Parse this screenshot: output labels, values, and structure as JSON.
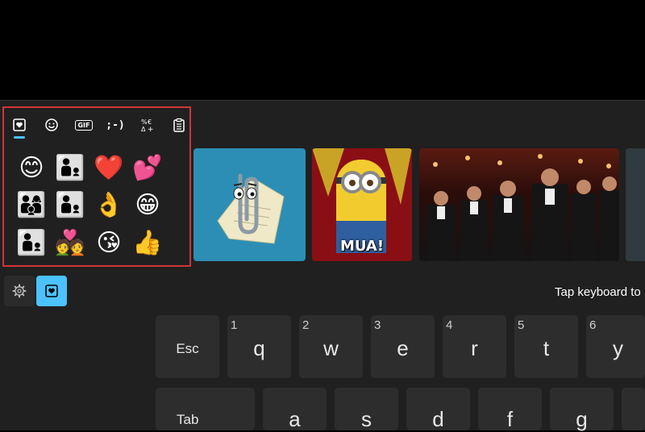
{
  "emoji_panel": {
    "tabs": [
      {
        "name": "favorites",
        "icon": "heart-clipboard-icon"
      },
      {
        "name": "emoji",
        "icon": "smiley-icon"
      },
      {
        "name": "gif",
        "label": "GIF"
      },
      {
        "name": "kaomoji",
        "label": ";-)"
      },
      {
        "name": "symbols",
        "icon": "symbols-icon"
      },
      {
        "name": "clipboard",
        "icon": "clipboard-icon"
      }
    ],
    "emojis": [
      "😊",
      "👨‍👦",
      "❤️",
      "💕",
      "👨‍👩‍👦",
      "👨‍👦",
      "👌",
      "😁",
      "👨‍👦",
      "💑",
      "😘",
      "👍"
    ]
  },
  "gif_strip": {
    "gif2_caption": "MUA!"
  },
  "bottom_bar": {
    "hint": "Tap keyboard to"
  },
  "keyboard": {
    "row1": [
      {
        "label": "Esc",
        "num": ""
      },
      {
        "label": "q",
        "num": "1"
      },
      {
        "label": "w",
        "num": "2"
      },
      {
        "label": "e",
        "num": "3"
      },
      {
        "label": "r",
        "num": "4"
      },
      {
        "label": "t",
        "num": "5"
      },
      {
        "label": "y",
        "num": "6"
      }
    ],
    "row2": [
      {
        "label": "Tab"
      },
      {
        "label": "a"
      },
      {
        "label": "s"
      },
      {
        "label": "d"
      },
      {
        "label": "f"
      },
      {
        "label": "g"
      }
    ]
  },
  "colors": {
    "accent": "#4cc2ff",
    "highlight_border": "#d13438",
    "panel_bg": "#202020",
    "key_bg": "#2d2d2d"
  }
}
